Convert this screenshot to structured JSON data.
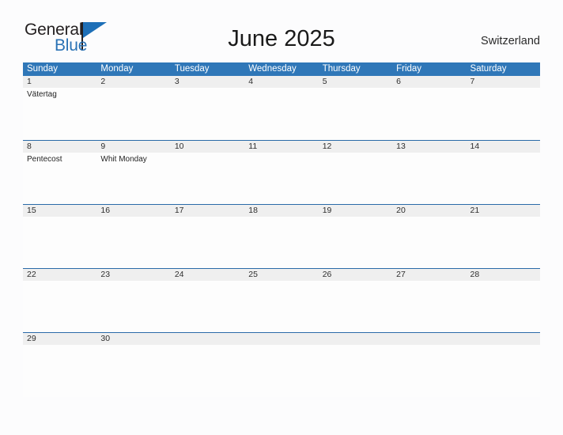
{
  "brand": {
    "name_part1": "General",
    "name_part2": "Blue",
    "flag_icon": "flag-triangle-icon",
    "accent_color": "#1d6fb7"
  },
  "header": {
    "title": "June 2025",
    "country": "Switzerland"
  },
  "theme": {
    "header_blue": "#2f77b8",
    "row_divider_blue": "#2a6aa8",
    "date_band_gray": "#efefef",
    "page_background": "#fcfcfd"
  },
  "calendar": {
    "month": "June",
    "year": "2025",
    "weekday_headers": [
      "Sunday",
      "Monday",
      "Tuesday",
      "Wednesday",
      "Thursday",
      "Friday",
      "Saturday"
    ],
    "weeks": [
      {
        "days": [
          {
            "num": "1",
            "events": [
              "Vätertag"
            ]
          },
          {
            "num": "2",
            "events": []
          },
          {
            "num": "3",
            "events": []
          },
          {
            "num": "4",
            "events": []
          },
          {
            "num": "5",
            "events": []
          },
          {
            "num": "6",
            "events": []
          },
          {
            "num": "7",
            "events": []
          }
        ]
      },
      {
        "days": [
          {
            "num": "8",
            "events": [
              "Pentecost"
            ]
          },
          {
            "num": "9",
            "events": [
              "Whit Monday"
            ]
          },
          {
            "num": "10",
            "events": []
          },
          {
            "num": "11",
            "events": []
          },
          {
            "num": "12",
            "events": []
          },
          {
            "num": "13",
            "events": []
          },
          {
            "num": "14",
            "events": []
          }
        ]
      },
      {
        "days": [
          {
            "num": "15",
            "events": []
          },
          {
            "num": "16",
            "events": []
          },
          {
            "num": "17",
            "events": []
          },
          {
            "num": "18",
            "events": []
          },
          {
            "num": "19",
            "events": []
          },
          {
            "num": "20",
            "events": []
          },
          {
            "num": "21",
            "events": []
          }
        ]
      },
      {
        "days": [
          {
            "num": "22",
            "events": []
          },
          {
            "num": "23",
            "events": []
          },
          {
            "num": "24",
            "events": []
          },
          {
            "num": "25",
            "events": []
          },
          {
            "num": "26",
            "events": []
          },
          {
            "num": "27",
            "events": []
          },
          {
            "num": "28",
            "events": []
          }
        ]
      },
      {
        "days": [
          {
            "num": "29",
            "events": []
          },
          {
            "num": "30",
            "events": []
          },
          {
            "num": "",
            "events": []
          },
          {
            "num": "",
            "events": []
          },
          {
            "num": "",
            "events": []
          },
          {
            "num": "",
            "events": []
          },
          {
            "num": "",
            "events": []
          }
        ]
      }
    ]
  }
}
